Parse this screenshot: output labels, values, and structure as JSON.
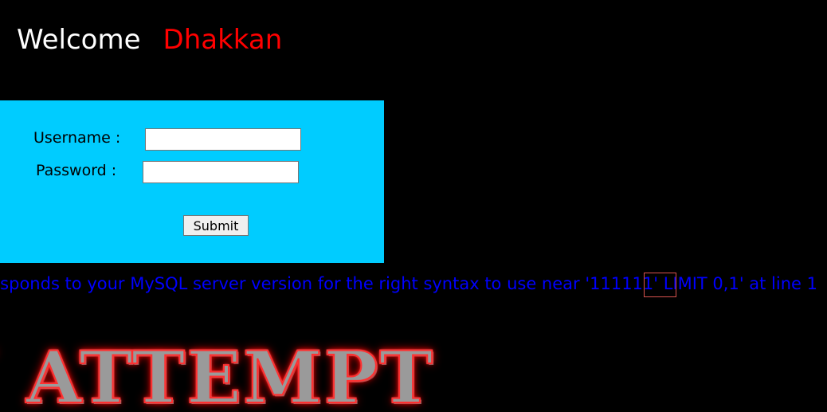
{
  "header": {
    "welcome_label": "Welcome",
    "user_name": "Dhakkan"
  },
  "login_form": {
    "username_label": "Username :",
    "password_label": "Password :",
    "username_value": "",
    "password_value": "",
    "submit_label": "Submit"
  },
  "error_message": "responds to your MySQL server version for the right syntax to use near '111111' LIMIT 0,1' at line 1",
  "banner_text": "N ATTEMPT",
  "colors": {
    "background": "#000000",
    "form_background": "#00ccff",
    "welcome_text": "#ffffff",
    "user_name_text": "#ff0000",
    "error_text": "#0000ff"
  }
}
